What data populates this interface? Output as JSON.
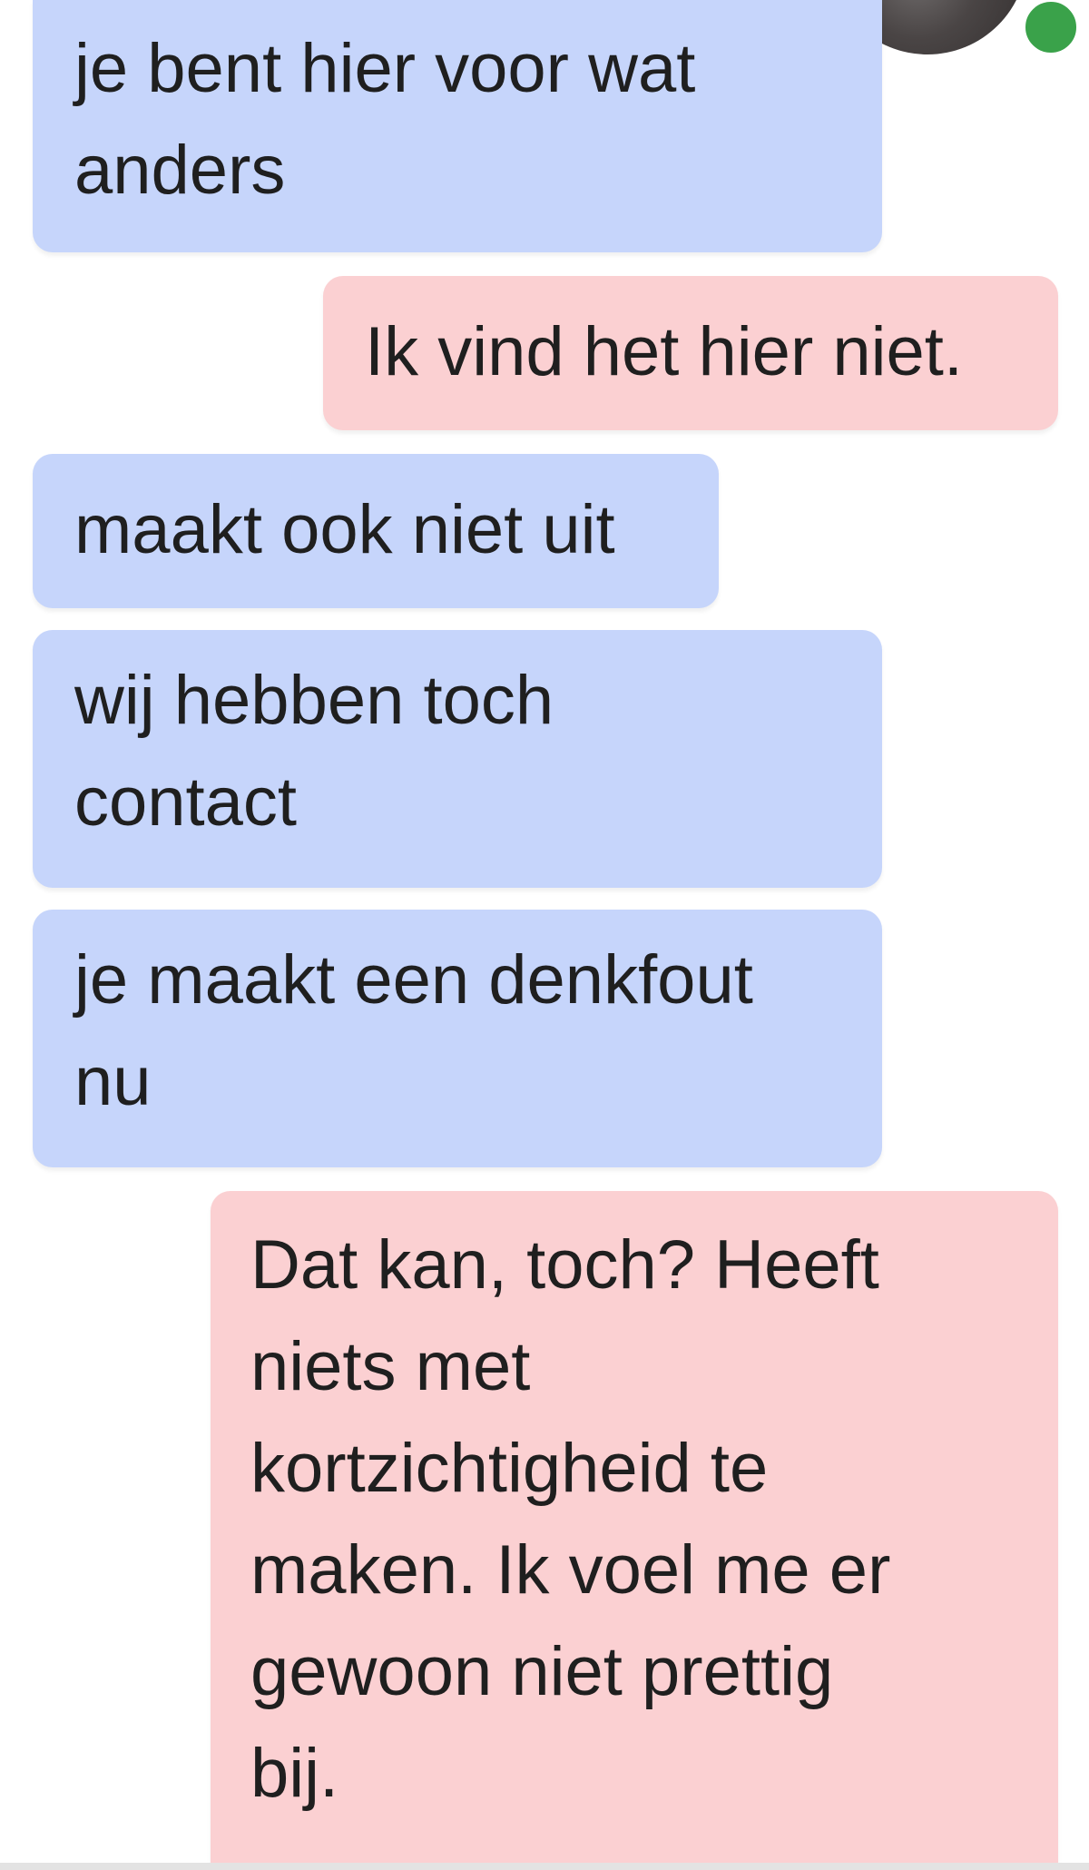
{
  "conversation": {
    "messages": [
      {
        "direction": "incoming",
        "text": "je bent hier voor wat\nanders"
      },
      {
        "direction": "outgoing",
        "text": "Ik vind het hier niet."
      },
      {
        "direction": "incoming",
        "text": "maakt ook niet uit"
      },
      {
        "direction": "incoming",
        "text": "wij hebben toch\ncontact"
      },
      {
        "direction": "incoming",
        "text": "je maakt een denkfout\nnu"
      },
      {
        "direction": "outgoing",
        "text": "Dat kan, toch? Heeft\nniets met\nkortzichtigheid te\nmaken. Ik voel me er\ngewoon niet prettig\nbij."
      }
    ]
  },
  "contact": {
    "status": "online"
  },
  "colors": {
    "incoming_bubble": "#c6d5fb",
    "outgoing_bubble": "#fbd0d2",
    "online_indicator": "#3aa24a",
    "text": "#1f1f1f"
  }
}
